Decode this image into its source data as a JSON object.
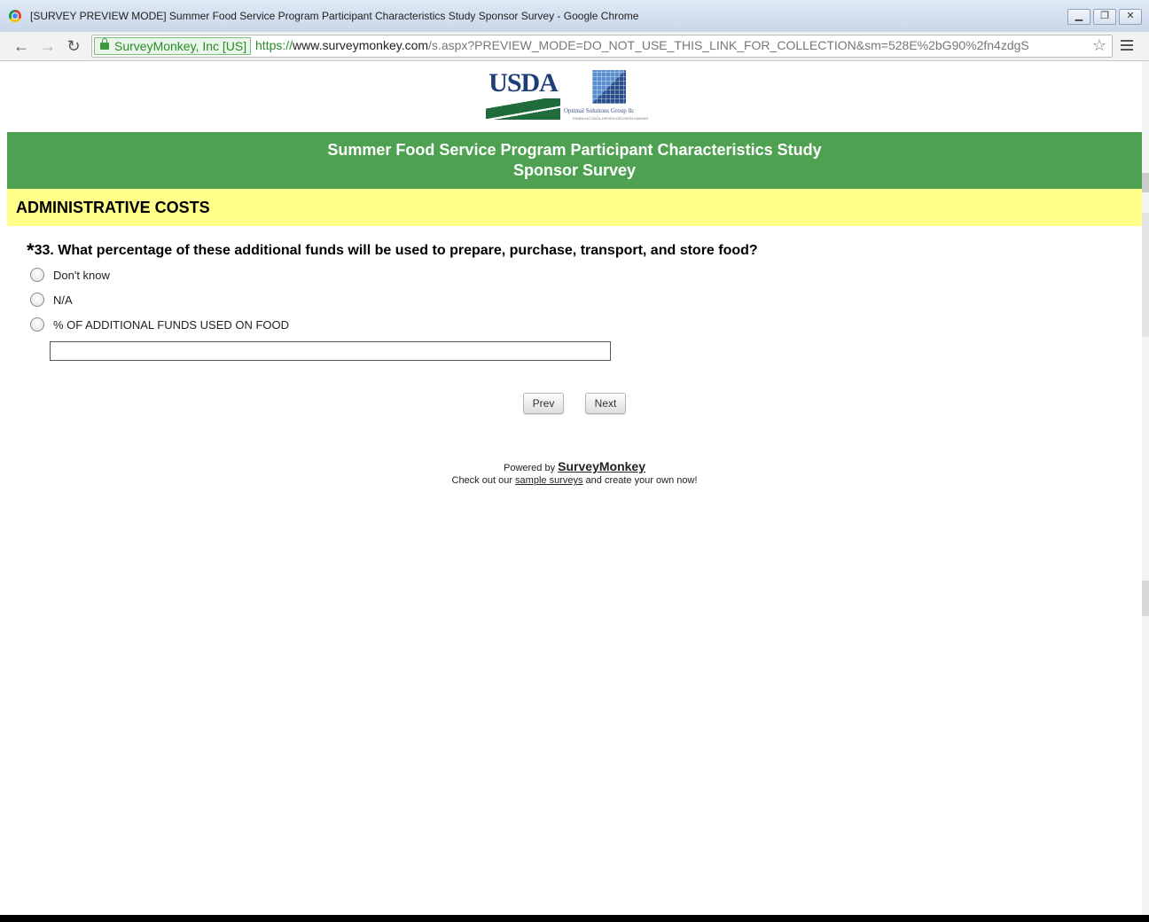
{
  "browser": {
    "window_title": "[SURVEY PREVIEW MODE] Summer Food Service Program Participant Characteristics Study Sponsor Survey - Google Chrome",
    "ev_label": "SurveyMonkey, Inc [US]",
    "url_scheme": "https://",
    "url_host": "www.surveymonkey.com",
    "url_path": "/s.aspx?PREVIEW_MODE=DO_NOT_USE_THIS_LINK_FOR_COLLECTION&sm=528E%2bG90%2fn4zdgS",
    "controls": {
      "minimize": "▁",
      "restore": "❐",
      "close": "✕"
    }
  },
  "logos": {
    "usda": "USDA",
    "osg": "Optimal Solutions Group llc",
    "osg_tag": "ENABLING DATA-DRIVEN DECISION MAKING"
  },
  "banner": {
    "line1": "Summer Food Service Program Participant Characteristics Study",
    "line2": "Sponsor Survey"
  },
  "section": {
    "title": "ADMINISTRATIVE COSTS"
  },
  "question": {
    "required_mark": "*",
    "text": "33. What percentage of these additional funds will be used to prepare, purchase, transport, and store food?",
    "options": [
      {
        "label": "Don't know"
      },
      {
        "label": "N/A"
      },
      {
        "label": "% OF ADDITIONAL FUNDS USED ON FOOD"
      }
    ],
    "text_value": ""
  },
  "nav": {
    "prev": "Prev",
    "next": "Next"
  },
  "footer": {
    "powered_by": "Powered by",
    "brand": "SurveyMonkey",
    "check_out": "Check out our",
    "sample_link": "sample surveys",
    "create": "and create your own now!"
  },
  "colors": {
    "banner": "#4ea150",
    "section": "#ffff8a"
  }
}
